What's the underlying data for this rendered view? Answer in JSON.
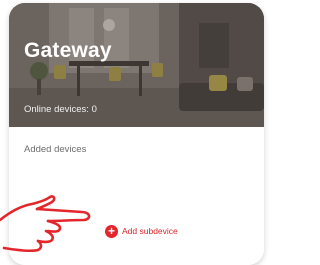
{
  "gateway": {
    "title": "Gateway",
    "online_devices_label": "Online devices: 0"
  },
  "devices": {
    "section_label": "Added devices",
    "add_subdevice_label": "Add subdevice"
  },
  "colors": {
    "accent": "#e3262b",
    "hero_tint": "#7c726b",
    "pointer_hand": "#e3262b"
  },
  "icons": {
    "add": "plus-circle-icon",
    "pointer": "pointing-hand-icon"
  }
}
